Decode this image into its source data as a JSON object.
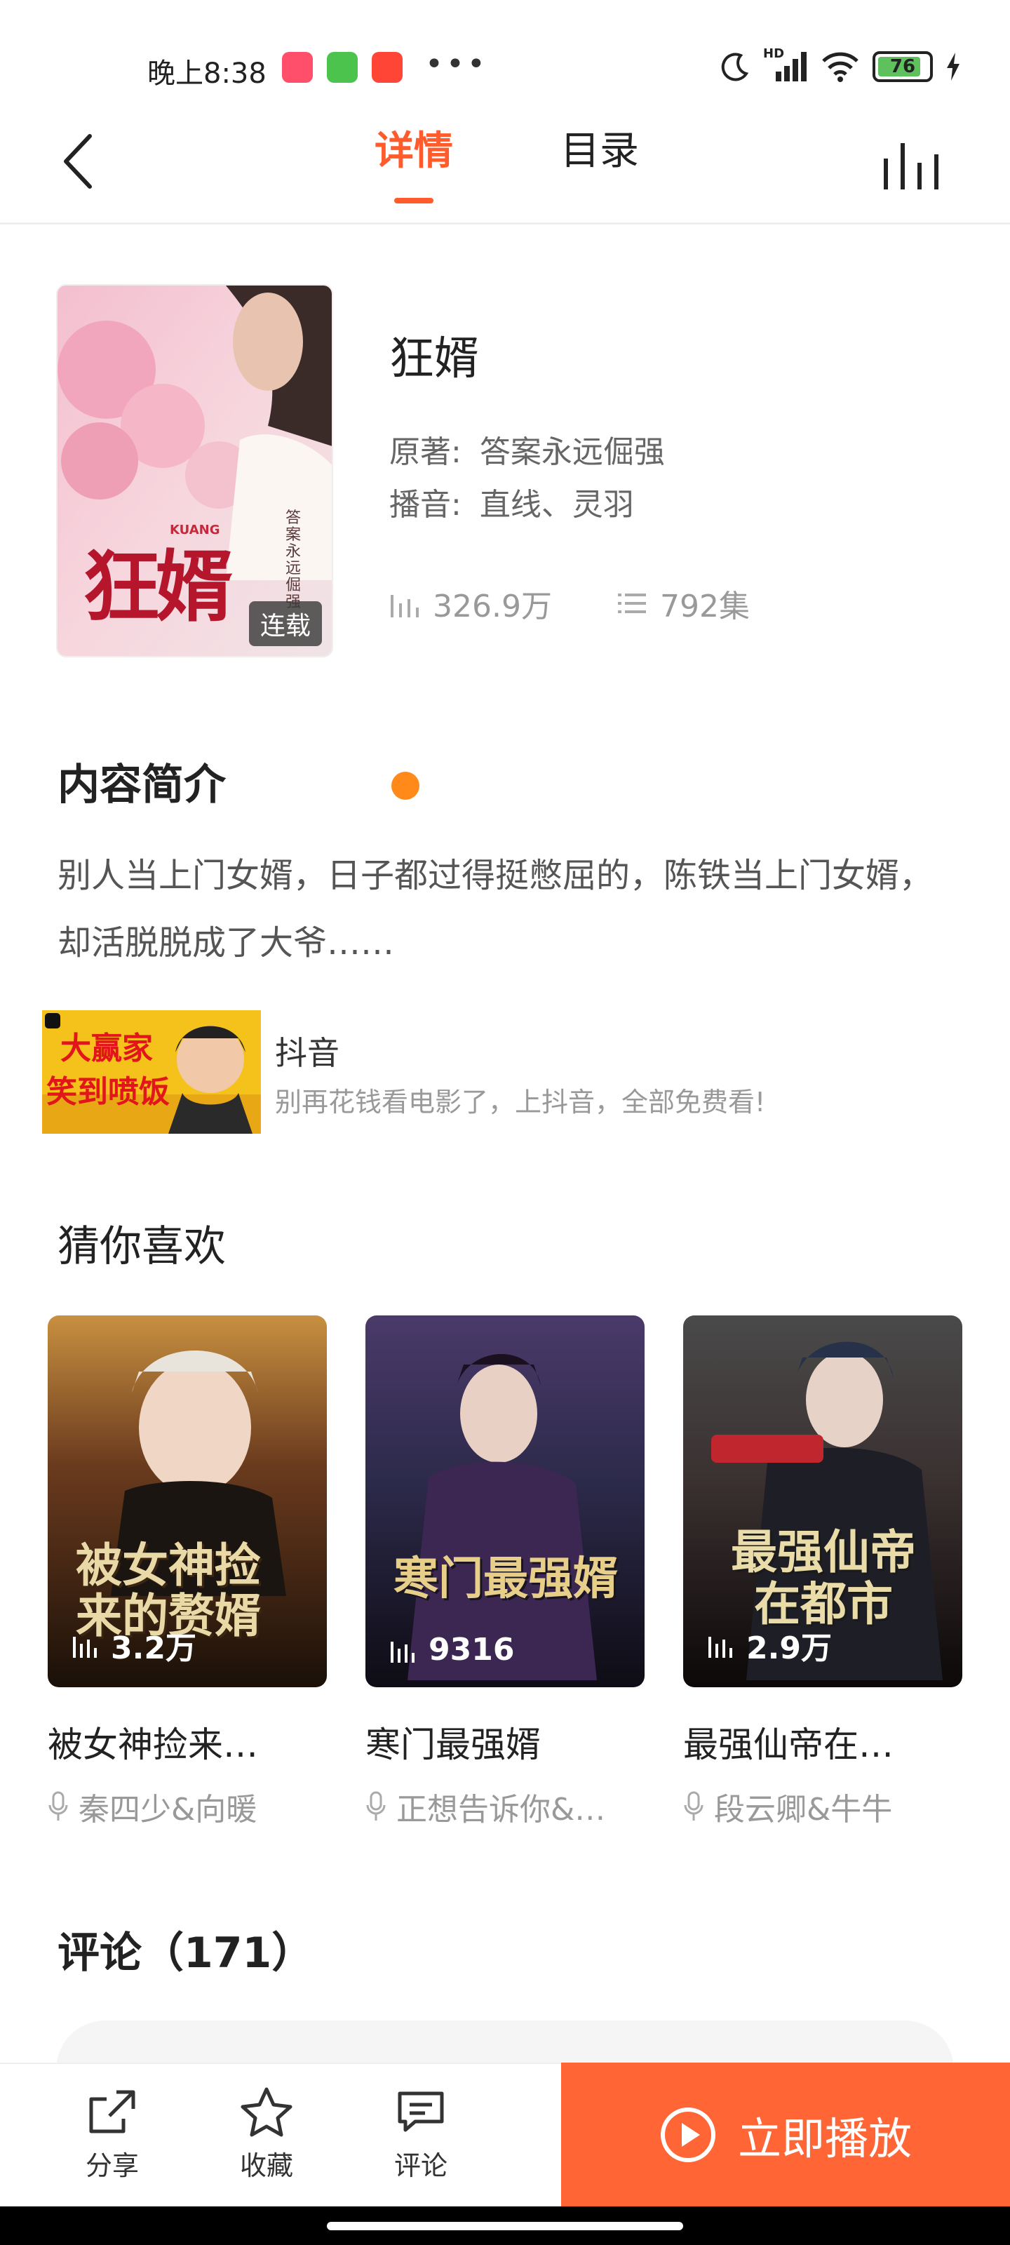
{
  "status_bar": {
    "time": "晚上8:38",
    "battery": "76",
    "network": "HD",
    "overflow": "•••"
  },
  "nav": {
    "tab_details": "详情",
    "tab_catalog": "目录"
  },
  "book": {
    "title": "狂婿",
    "author_label": "原著:",
    "author": "答案永远倔强",
    "narrator_label": "播音:",
    "narrators": "直线、灵羽",
    "plays": "326.9万",
    "episodes": "792集",
    "status_tag": "连载",
    "cover_text": "狂婿",
    "cover_subtitle": "KUANG",
    "cover_author": "答案永远倔强"
  },
  "intro": {
    "heading": "内容简介",
    "text": "别人当上门女婿，日子都过得挺憋屈的，陈铁当上门女婿，却活脱脱成了大爷……"
  },
  "ad": {
    "title": "抖音",
    "description": "别再花钱看电影了，上抖音，全部免费看!",
    "banner_line1": "大赢家",
    "banner_line2": "笑到喷饭"
  },
  "recommend": {
    "heading": "猜你喜欢",
    "items": [
      {
        "name": "被女神捡来…",
        "author": "秦四少&向暖",
        "plays": "3.2万",
        "cover_text": "被女神捡来的赘婿",
        "color": "#6b3b1e"
      },
      {
        "name": "寒门最强婿",
        "author": "正想告诉你&…",
        "plays": "9316",
        "cover_text": "寒门最强婿",
        "color": "#2c2a4a"
      },
      {
        "name": "最强仙帝在…",
        "author": "段云卿&牛牛",
        "plays": "2.9万",
        "cover_text": "最强仙帝在都市",
        "color": "#3a3030"
      }
    ]
  },
  "comments": {
    "heading": "评论（171）"
  },
  "bottom_bar": {
    "share": "分享",
    "favorite": "收藏",
    "comment": "评论",
    "play": "立即播放"
  },
  "colors": {
    "accent": "#ff5b2c",
    "play_button": "#ff6535"
  }
}
